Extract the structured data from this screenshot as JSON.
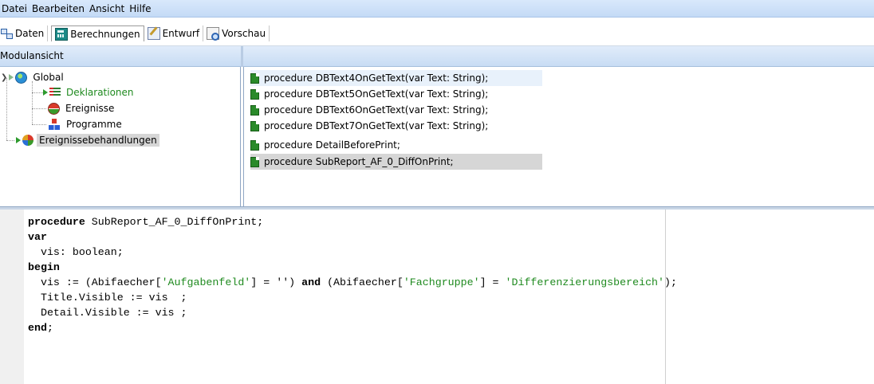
{
  "menu": [
    "Datei",
    "Bearbeiten",
    "Ansicht",
    "Hilfe"
  ],
  "tabs": [
    {
      "label": "Daten",
      "icon": "data-icon",
      "active": false
    },
    {
      "label": "Berechnungen",
      "icon": "calculator-icon",
      "active": true
    },
    {
      "label": "Entwurf",
      "icon": "design-icon",
      "active": false
    },
    {
      "label": "Vorschau",
      "icon": "preview-icon",
      "active": false
    }
  ],
  "module_view": {
    "title": "Modulansicht",
    "tree": {
      "root": "Global",
      "children": [
        "Deklarationen",
        "Ereignisse",
        "Programme"
      ],
      "sibling": "Ereignissebehandlungen"
    }
  },
  "procedures": [
    "procedure DBText4OnGetText(var Text: String);",
    "procedure DBText5OnGetText(var Text: String);",
    "procedure DBText6OnGetText(var Text: String);",
    "procedure DBText7OnGetText(var Text: String);",
    "procedure DetailBeforePrint;",
    "procedure SubReport_AF_0_DiffOnPrint;"
  ],
  "code": {
    "l1_kw": "procedure",
    "l1_rest": " SubReport_AF_0_DiffOnPrint;",
    "l2_kw": "var",
    "l3": "  vis: boolean;",
    "l4_kw": "begin",
    "l5_a": "  vis := (Abifaecher[",
    "l5_s1": "'Aufgabenfeld'",
    "l5_b": "] = '') ",
    "l5_kw": "and",
    "l5_c": " (Abifaecher[",
    "l5_s2": "'Fachgruppe'",
    "l5_d": "] = ",
    "l5_s3": "'Differenzierungsbereich'",
    "l5_e": ");",
    "l6": "  Title.Visible := vis  ;",
    "l7": "  Detail.Visible := vis ;",
    "l8_kw": "end",
    "l8_rest": ";"
  }
}
